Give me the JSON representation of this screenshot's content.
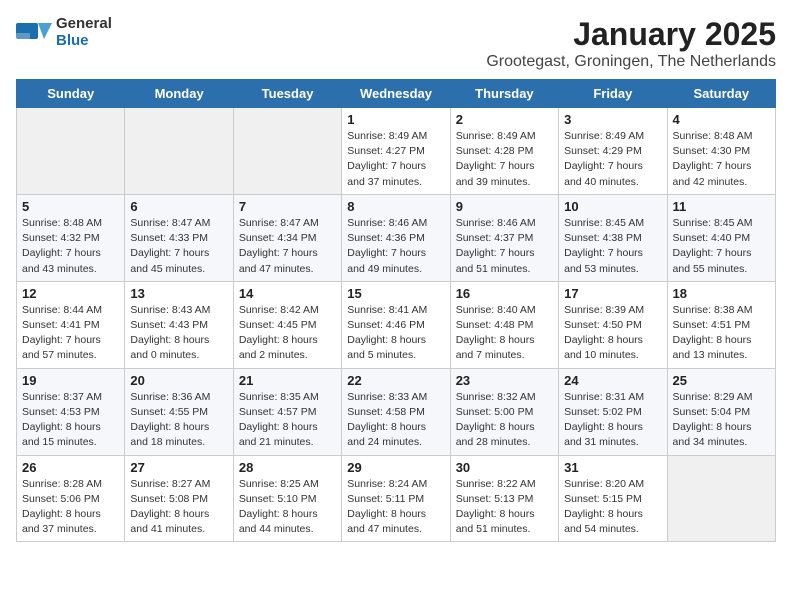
{
  "logo": {
    "line1": "General",
    "line2": "Blue"
  },
  "title": "January 2025",
  "subtitle": "Grootegast, Groningen, The Netherlands",
  "weekdays": [
    "Sunday",
    "Monday",
    "Tuesday",
    "Wednesday",
    "Thursday",
    "Friday",
    "Saturday"
  ],
  "weeks": [
    [
      {
        "day": "",
        "info": ""
      },
      {
        "day": "",
        "info": ""
      },
      {
        "day": "",
        "info": ""
      },
      {
        "day": "1",
        "info": "Sunrise: 8:49 AM\nSunset: 4:27 PM\nDaylight: 7 hours\nand 37 minutes."
      },
      {
        "day": "2",
        "info": "Sunrise: 8:49 AM\nSunset: 4:28 PM\nDaylight: 7 hours\nand 39 minutes."
      },
      {
        "day": "3",
        "info": "Sunrise: 8:49 AM\nSunset: 4:29 PM\nDaylight: 7 hours\nand 40 minutes."
      },
      {
        "day": "4",
        "info": "Sunrise: 8:48 AM\nSunset: 4:30 PM\nDaylight: 7 hours\nand 42 minutes."
      }
    ],
    [
      {
        "day": "5",
        "info": "Sunrise: 8:48 AM\nSunset: 4:32 PM\nDaylight: 7 hours\nand 43 minutes."
      },
      {
        "day": "6",
        "info": "Sunrise: 8:47 AM\nSunset: 4:33 PM\nDaylight: 7 hours\nand 45 minutes."
      },
      {
        "day": "7",
        "info": "Sunrise: 8:47 AM\nSunset: 4:34 PM\nDaylight: 7 hours\nand 47 minutes."
      },
      {
        "day": "8",
        "info": "Sunrise: 8:46 AM\nSunset: 4:36 PM\nDaylight: 7 hours\nand 49 minutes."
      },
      {
        "day": "9",
        "info": "Sunrise: 8:46 AM\nSunset: 4:37 PM\nDaylight: 7 hours\nand 51 minutes."
      },
      {
        "day": "10",
        "info": "Sunrise: 8:45 AM\nSunset: 4:38 PM\nDaylight: 7 hours\nand 53 minutes."
      },
      {
        "day": "11",
        "info": "Sunrise: 8:45 AM\nSunset: 4:40 PM\nDaylight: 7 hours\nand 55 minutes."
      }
    ],
    [
      {
        "day": "12",
        "info": "Sunrise: 8:44 AM\nSunset: 4:41 PM\nDaylight: 7 hours\nand 57 minutes."
      },
      {
        "day": "13",
        "info": "Sunrise: 8:43 AM\nSunset: 4:43 PM\nDaylight: 8 hours\nand 0 minutes."
      },
      {
        "day": "14",
        "info": "Sunrise: 8:42 AM\nSunset: 4:45 PM\nDaylight: 8 hours\nand 2 minutes."
      },
      {
        "day": "15",
        "info": "Sunrise: 8:41 AM\nSunset: 4:46 PM\nDaylight: 8 hours\nand 5 minutes."
      },
      {
        "day": "16",
        "info": "Sunrise: 8:40 AM\nSunset: 4:48 PM\nDaylight: 8 hours\nand 7 minutes."
      },
      {
        "day": "17",
        "info": "Sunrise: 8:39 AM\nSunset: 4:50 PM\nDaylight: 8 hours\nand 10 minutes."
      },
      {
        "day": "18",
        "info": "Sunrise: 8:38 AM\nSunset: 4:51 PM\nDaylight: 8 hours\nand 13 minutes."
      }
    ],
    [
      {
        "day": "19",
        "info": "Sunrise: 8:37 AM\nSunset: 4:53 PM\nDaylight: 8 hours\nand 15 minutes."
      },
      {
        "day": "20",
        "info": "Sunrise: 8:36 AM\nSunset: 4:55 PM\nDaylight: 8 hours\nand 18 minutes."
      },
      {
        "day": "21",
        "info": "Sunrise: 8:35 AM\nSunset: 4:57 PM\nDaylight: 8 hours\nand 21 minutes."
      },
      {
        "day": "22",
        "info": "Sunrise: 8:33 AM\nSunset: 4:58 PM\nDaylight: 8 hours\nand 24 minutes."
      },
      {
        "day": "23",
        "info": "Sunrise: 8:32 AM\nSunset: 5:00 PM\nDaylight: 8 hours\nand 28 minutes."
      },
      {
        "day": "24",
        "info": "Sunrise: 8:31 AM\nSunset: 5:02 PM\nDaylight: 8 hours\nand 31 minutes."
      },
      {
        "day": "25",
        "info": "Sunrise: 8:29 AM\nSunset: 5:04 PM\nDaylight: 8 hours\nand 34 minutes."
      }
    ],
    [
      {
        "day": "26",
        "info": "Sunrise: 8:28 AM\nSunset: 5:06 PM\nDaylight: 8 hours\nand 37 minutes."
      },
      {
        "day": "27",
        "info": "Sunrise: 8:27 AM\nSunset: 5:08 PM\nDaylight: 8 hours\nand 41 minutes."
      },
      {
        "day": "28",
        "info": "Sunrise: 8:25 AM\nSunset: 5:10 PM\nDaylight: 8 hours\nand 44 minutes."
      },
      {
        "day": "29",
        "info": "Sunrise: 8:24 AM\nSunset: 5:11 PM\nDaylight: 8 hours\nand 47 minutes."
      },
      {
        "day": "30",
        "info": "Sunrise: 8:22 AM\nSunset: 5:13 PM\nDaylight: 8 hours\nand 51 minutes."
      },
      {
        "day": "31",
        "info": "Sunrise: 8:20 AM\nSunset: 5:15 PM\nDaylight: 8 hours\nand 54 minutes."
      },
      {
        "day": "",
        "info": ""
      }
    ]
  ]
}
